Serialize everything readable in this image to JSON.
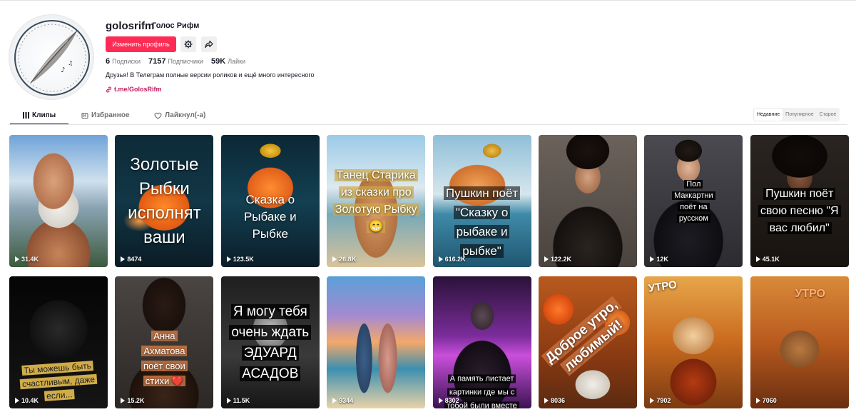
{
  "profile": {
    "username": "golosrifm",
    "nickname": "Голос Рифм",
    "edit_button": "Изменить профиль",
    "stats": {
      "following_count": "6",
      "following_label": "Подписки",
      "followers_count": "7157",
      "followers_label": "Подписчики",
      "likes_count": "59K",
      "likes_label": "Лайки"
    },
    "bio": "Друзья! В Телеграм полные версии роликов и ещё много интересного",
    "link": "t.me/GolosRifm"
  },
  "tabs": [
    {
      "label": "Клипы",
      "icon": "grid-icon"
    },
    {
      "label": "Избранное",
      "icon": "bookmark-icon"
    },
    {
      "label": "Лайкнул(-а)",
      "icon": "heart-outline-icon"
    }
  ],
  "sort": [
    "Недавние",
    "Популярное",
    "Старое"
  ],
  "colors": {
    "accent": "#fe2c55",
    "link": "#c2185b"
  },
  "videos": [
    {
      "views": "31.4K",
      "caption": ""
    },
    {
      "views": "8474",
      "caption": "Золотые Рыбки исполнят ваши"
    },
    {
      "views": "123.5K",
      "caption": "Сказка о Рыбаке и Рыбке"
    },
    {
      "views": "26.8K",
      "caption": "Танец Старика из сказки про Золотую Рыбку 😁"
    },
    {
      "views": "616.2K",
      "caption": "Пушкин поёт \"Сказку о рыбаке и рыбке\""
    },
    {
      "views": "122.2K",
      "caption": ""
    },
    {
      "views": "12K",
      "caption": "Пол Маккартни поёт на русском"
    },
    {
      "views": "45.1K",
      "caption": "Пушкин поёт свою песню \"Я вас любил\""
    },
    {
      "views": "10.4K",
      "caption": "Ты можешь быть счастливым, даже если..."
    },
    {
      "views": "15.2K",
      "caption": "Анна Ахматова поёт свои стихи ❤️"
    },
    {
      "views": "11.5K",
      "caption": "Я могу тебя очень ждать ЭДУАРД АСАДОВ"
    },
    {
      "views": "9344",
      "caption": ""
    },
    {
      "views": "8302",
      "caption": "А память листает картинки где мы с тобой были вместе"
    },
    {
      "views": "8036",
      "caption": "Доброе утро, любимый!"
    },
    {
      "views": "7902",
      "caption": "УТРО"
    },
    {
      "views": "7060",
      "caption": "УТРО"
    }
  ]
}
